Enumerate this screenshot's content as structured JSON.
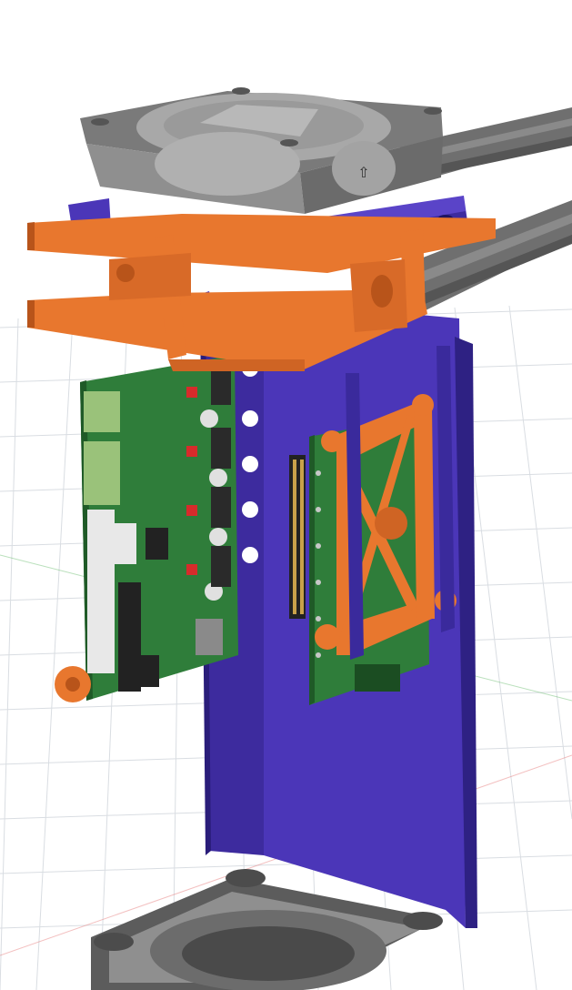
{
  "viewport": {
    "background": "#ffffff",
    "grid_color": "#d9dde2",
    "x_axis_color": "#e57373",
    "z_axis_color": "#66bb6a"
  },
  "scene": {
    "components": [
      "top-fan",
      "fan-duct-mount-blue",
      "orange-frame-bracket",
      "extrusion-rails",
      "control-board",
      "raspberry-pi-board",
      "orange-board-bracket",
      "blue-enclosure-panel",
      "bottom-fan"
    ],
    "colors": {
      "orange": "#e8772e",
      "orange_dark": "#b8541a",
      "blue": "#4b36b8",
      "blue_dark": "#2e2183",
      "pcb_green": "#2f7d3a",
      "pcb_dark": "#1f5a27",
      "fan_gray": "#8f8f8f",
      "fan_dark": "#5c5c5c",
      "rail_gray": "#6f6f6f"
    },
    "fan_arrow_glyph": "⇧"
  }
}
